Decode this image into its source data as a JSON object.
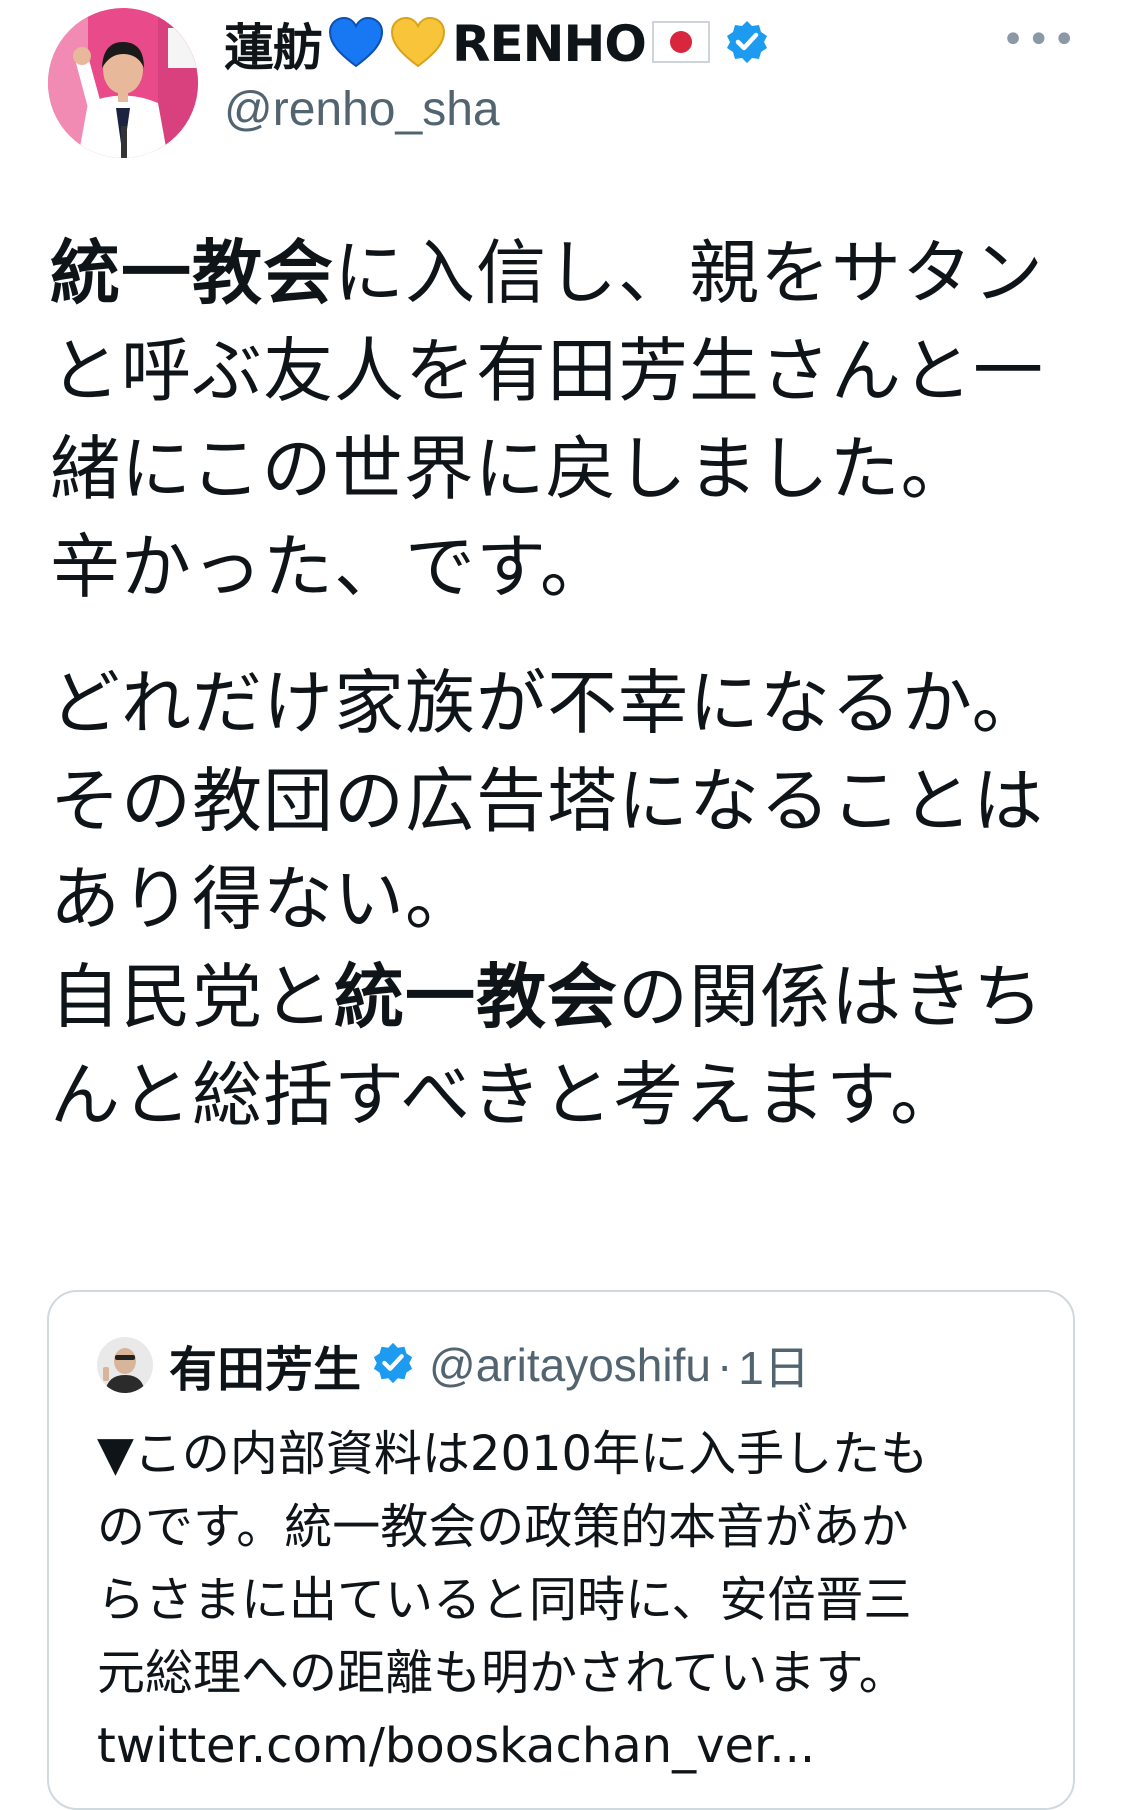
{
  "author": {
    "display_name_part1": "蓮舫",
    "display_name_part2": "RENHO",
    "handle": "@renho_sha",
    "more_label": "•••",
    "icons": [
      "blue-heart-icon",
      "yellow-heart-icon",
      "japan-flag-icon",
      "verified-badge-icon"
    ]
  },
  "tweet": {
    "lines1": [
      {
        "bold": "統一教会",
        "rest": "に入信し、親をサタン"
      },
      {
        "bold": "",
        "rest": "と呼ぶ友人を有田芳生さんと一"
      },
      {
        "bold": "",
        "rest": "緒にこの世界に戻しました。"
      },
      {
        "bold": "",
        "rest": "辛かった、です。"
      }
    ],
    "line5": "どれだけ家族が不幸になるか。",
    "line6": "その教団の広告塔になることは",
    "line7": "あり得ない。",
    "line8_pre": "自民党と",
    "line8_bold": "統一教会",
    "line8_post": "の関係はきち",
    "line9": "んと総括すべきと考えます。"
  },
  "quote": {
    "name": "有田芳生",
    "handle": "@aritayoshifu",
    "dot": "·",
    "time": "1日",
    "line1": "▼この内部資料は2010年に入手したも",
    "line2": "のです。統一教会の政策的本音があか",
    "line3": "らさまに出ていると同時に、安倍晋三",
    "line4": "元総理への距離も明かされています。",
    "link": "twitter.com/booskachan_ver..."
  }
}
